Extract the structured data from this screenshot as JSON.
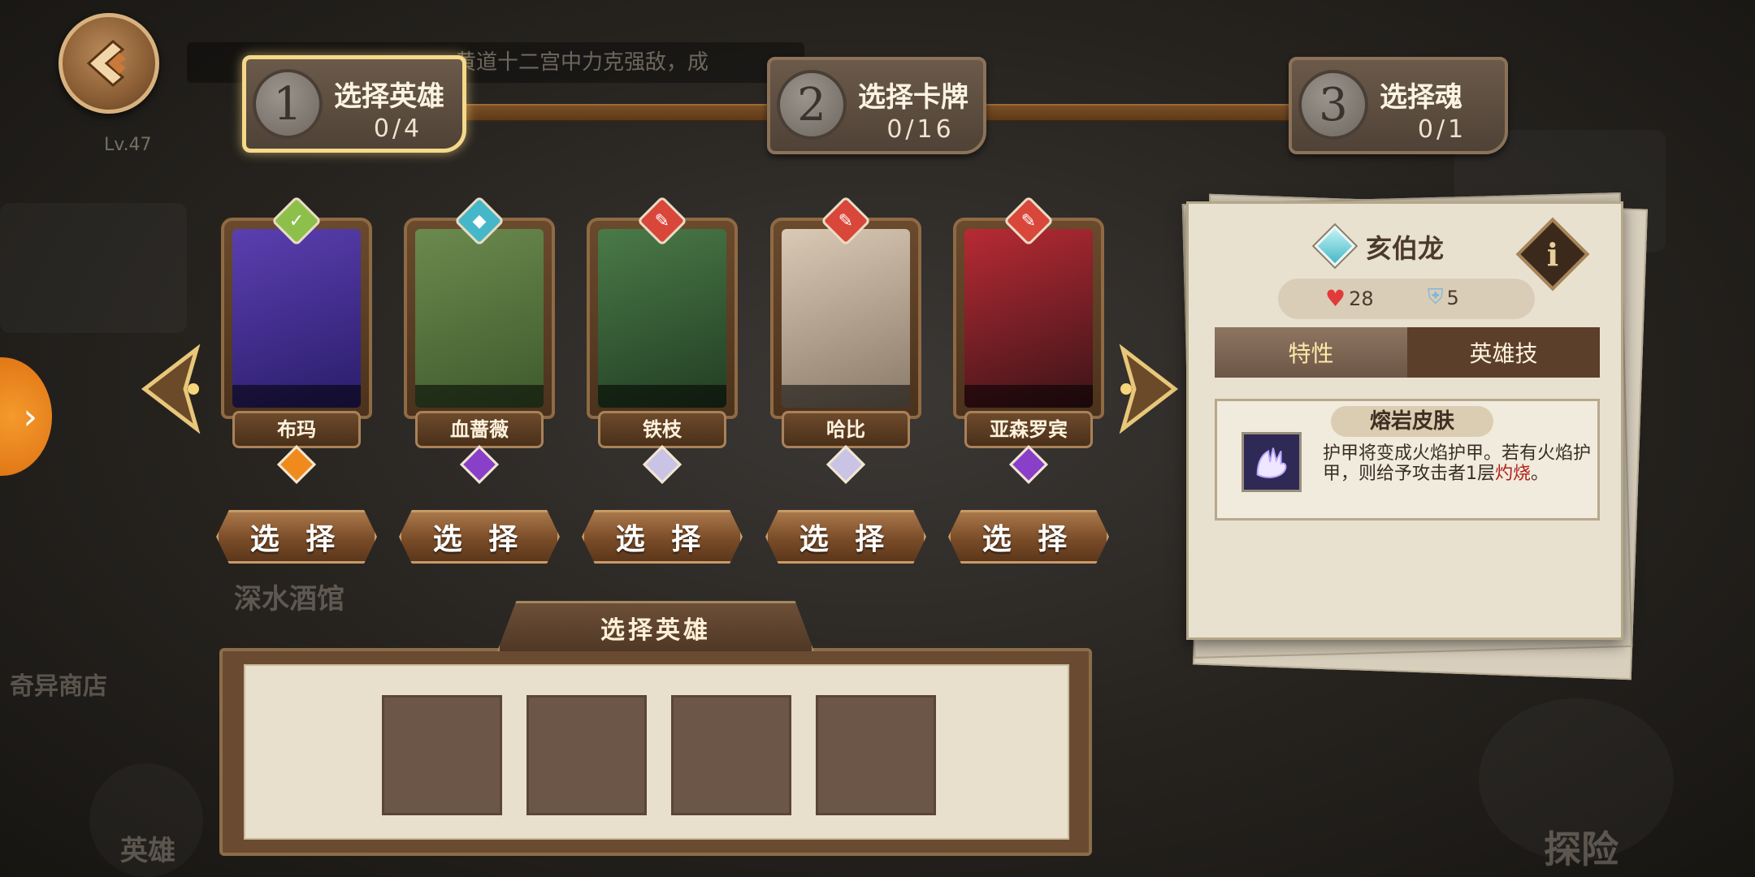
{
  "header": {
    "level": "Lv.47",
    "banner_text": "黄道十二宫中力克强敌，成"
  },
  "steps": [
    {
      "num": "1",
      "title": "选择英雄",
      "count": "0/4",
      "active": true
    },
    {
      "num": "2",
      "title": "选择卡牌",
      "count": "0/16",
      "active": false
    },
    {
      "num": "3",
      "title": "选择魂",
      "count": "0/1",
      "active": false
    }
  ],
  "heroes": [
    {
      "name": "布玛",
      "class_color": "#8cc04a",
      "class_glyph": "✓",
      "gem_color": "#f08a1c",
      "portrait": [
        "#5a3fb0",
        "#2a1d6a"
      ]
    },
    {
      "name": "血蔷薇",
      "class_color": "#45b7c9",
      "class_glyph": "◆",
      "gem_color": "#8a3fc9",
      "portrait": [
        "#6b8a4e",
        "#3e5a2c"
      ]
    },
    {
      "name": "铁枝",
      "class_color": "#d8473a",
      "class_glyph": "✎",
      "gem_color": "#c9c3e6",
      "portrait": [
        "#4a7a48",
        "#223d22"
      ]
    },
    {
      "name": "哈比",
      "class_color": "#d8473a",
      "class_glyph": "✎",
      "gem_color": "#c9c3e6",
      "portrait": [
        "#d9c9b5",
        "#8a7a68"
      ]
    },
    {
      "name": "亚森罗宾",
      "class_color": "#d8473a",
      "class_glyph": "✎",
      "gem_color": "#8a3fc9",
      "portrait": [
        "#b82a34",
        "#3a1418"
      ]
    }
  ],
  "select_label": "选 择",
  "background_labels": {
    "tavern": "深水酒馆",
    "shop": "奇异商店",
    "hero": "英雄",
    "explore": "探险"
  },
  "panel": {
    "hero_name": "亥伯龙",
    "hp": "28",
    "armor": "5",
    "tab_trait": "特性",
    "tab_skill": "英雄技",
    "trait_title": "熔岩皮肤",
    "trait_desc_1": "护甲将变成火焰护甲。若有火焰护甲，则给予攻击者1层",
    "trait_desc_hl": "灼烧",
    "trait_desc_2": "。"
  },
  "selection": {
    "title": "选择英雄",
    "slot_count": 4
  },
  "colors": {
    "accent_gold": "#f5d98a",
    "brown_dark": "#4f3826",
    "highlight_red": "#b0231b"
  }
}
